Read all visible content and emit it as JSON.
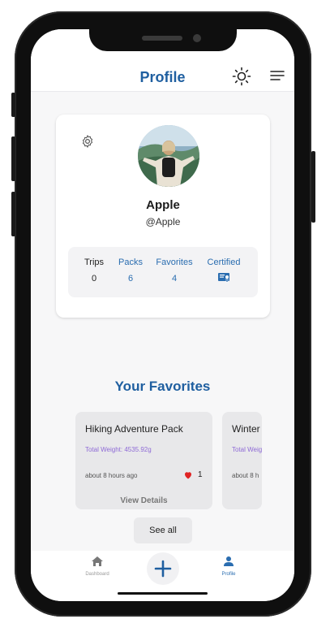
{
  "header": {
    "title": "Profile"
  },
  "profile": {
    "name": "Apple",
    "handle": "@Apple",
    "stats": [
      {
        "label": "Trips",
        "value": "0"
      },
      {
        "label": "Packs",
        "value": "6"
      },
      {
        "label": "Favorites",
        "value": "4"
      },
      {
        "label": "Certified",
        "icon": "certificate-icon"
      }
    ]
  },
  "favorites": {
    "title": "Your Favorites",
    "cards": [
      {
        "name": "Hiking Adventure Pack",
        "weight": "Total Weight: 4535.92g",
        "time": "about 8 hours ago",
        "likes": "1",
        "view_label": "View Details"
      },
      {
        "name": "Winter",
        "weight": "Total Weig",
        "time": "about 8 h"
      }
    ],
    "see_all": "See all"
  },
  "tabs": [
    {
      "label": "Dashboard",
      "icon": "home-icon"
    },
    {
      "label": "",
      "icon": "plus-icon"
    },
    {
      "label": "Profile",
      "icon": "person-icon"
    }
  ],
  "colors": {
    "accent": "#1f5fa0",
    "link": "#2a6db0",
    "weight": "#8e6ad6",
    "heart": "#e02424"
  }
}
